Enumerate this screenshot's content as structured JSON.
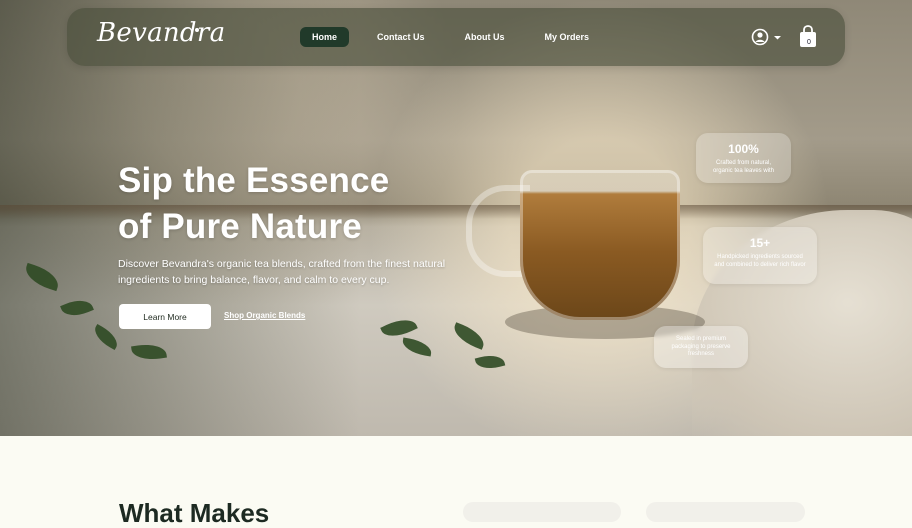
{
  "nav": {
    "logo": "Bevandra",
    "items": [
      {
        "label": "Home",
        "active": true
      },
      {
        "label": "Contact Us",
        "active": false
      },
      {
        "label": "About Us",
        "active": false
      },
      {
        "label": "My Orders",
        "active": false
      }
    ],
    "user_icon": "user-icon",
    "cart_icon": "shopping-bag-icon",
    "cart_count": "0"
  },
  "hero": {
    "title_line1": "Sip the Essence",
    "title_line2": "of Pure Nature",
    "description": "Discover Bevandra's organic tea blends, crafted from the finest natural ingredients to bring balance, flavor, and calm to every cup.",
    "primary_button": "Learn More",
    "secondary_link": "Shop Organic Blends"
  },
  "stats": [
    {
      "value": "100%",
      "text": "Crafted from natural, organic tea leaves with"
    },
    {
      "value": "15+",
      "text": "Handpicked ingredients sourced and combined to deliver rich flavor"
    },
    {
      "value": "",
      "text": "Sealed in premium packaging to preserve freshness"
    }
  ],
  "section": {
    "title_partial": "What Makes"
  },
  "colors": {
    "nav_active_bg": "#213a2a",
    "page_bg": "#fbfbf3",
    "accent_dark": "#1d2a22"
  }
}
